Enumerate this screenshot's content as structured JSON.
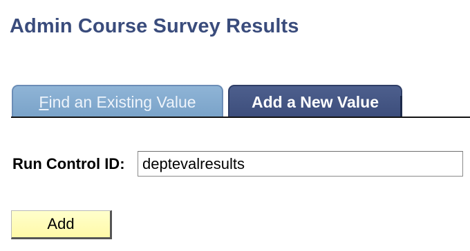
{
  "page": {
    "title": "Admin Course Survey Results"
  },
  "tabs": [
    {
      "label_accel": "F",
      "label_rest": "ind an Existing Value",
      "active": false
    },
    {
      "label": "Add a New Value",
      "active": true
    }
  ],
  "form": {
    "run_control_label": "Run Control ID:",
    "run_control_value": "deptevalresults",
    "add_button_label": "Add"
  },
  "colors": {
    "title": "#3a4c7c",
    "tab_inactive": "#7aa3c9",
    "tab_active": "#3d4e7c",
    "add_button": "#fff9a8"
  }
}
